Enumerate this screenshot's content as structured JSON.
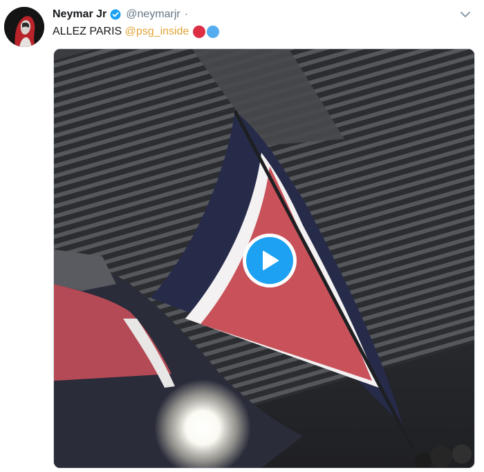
{
  "tweet": {
    "author_name": "Neymar Jr",
    "author_handle": "@neymarjr",
    "separator": "·",
    "text": "ALLEZ PARIS ",
    "mention": "@psg_inside",
    "emoji": [
      "red-circle",
      "blue-circle"
    ],
    "verified": true,
    "media_type": "video"
  },
  "icons": {
    "verified": "verified-badge-icon",
    "caret": "chevron-down-icon",
    "play": "play-icon"
  },
  "colors": {
    "mention": "#e3a336",
    "verified": "#1da1f2",
    "play": "#1da1f2",
    "flag_red": "#c9525a",
    "flag_blue": "#272b4a",
    "handle": "#657786"
  }
}
